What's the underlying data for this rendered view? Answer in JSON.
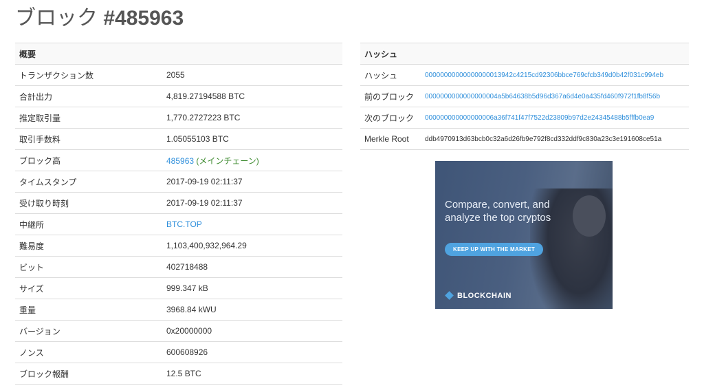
{
  "page": {
    "title_prefix": "ブロック ",
    "title_number": "#485963"
  },
  "summary": {
    "header": "概要",
    "rows": [
      {
        "label": "トランザクション数",
        "value": "2055"
      },
      {
        "label": "合計出力",
        "value": "4,819.27194588 BTC"
      },
      {
        "label": "推定取引量",
        "value": "1,770.2727223 BTC"
      },
      {
        "label": "取引手数料",
        "value": "1.05055103 BTC"
      },
      {
        "label": "ブロック高",
        "link": "485963",
        "suffix": "(メインチェーン)"
      },
      {
        "label": "タイムスタンプ",
        "value": "2017-09-19 02:11:37"
      },
      {
        "label": "受け取り時刻",
        "value": "2017-09-19 02:11:37"
      },
      {
        "label": "中継所",
        "link": "BTC.TOP"
      },
      {
        "label": "難易度",
        "value": "1,103,400,932,964.29"
      },
      {
        "label": "ビット",
        "value": "402718488"
      },
      {
        "label": "サイズ",
        "value": "999.347 kB"
      },
      {
        "label": "重量",
        "value": "3968.84 kWU"
      },
      {
        "label": "バージョン",
        "value": "0x20000000"
      },
      {
        "label": "ノンス",
        "value": "600608926"
      },
      {
        "label": "ブロック報酬",
        "value": "12.5 BTC"
      }
    ]
  },
  "hashes": {
    "header": "ハッシュ",
    "rows": [
      {
        "label": "ハッシュ",
        "value": "00000000000000000013942c4215cd92306bbce769cfcb349d0b42f031c994eb"
      },
      {
        "label": "前のブロック",
        "value": "0000000000000000004a5b64638b5d96d367a6d4e0a435fd460f972f1fb8f56b"
      },
      {
        "label": "次のブロック",
        "value": "000000000000000006a36f741f47f7522d23809b97d2e24345488b5fffb0ea9"
      },
      {
        "label": "Merkle Root",
        "value": "ddb4970913d63bcb0c32a6d26fb9e792f8cd332ddf9c830a23c3e191608ce51a"
      }
    ]
  },
  "ad": {
    "headline": "Compare, convert, and analyze the top cryptos",
    "cta": "KEEP UP WITH THE MARKET",
    "brand": "BLOCKCHAIN"
  },
  "colors": {
    "link": "#2f8fdb",
    "main_chain": "#3c8a2e",
    "ad_accent": "#4fa3e0"
  }
}
